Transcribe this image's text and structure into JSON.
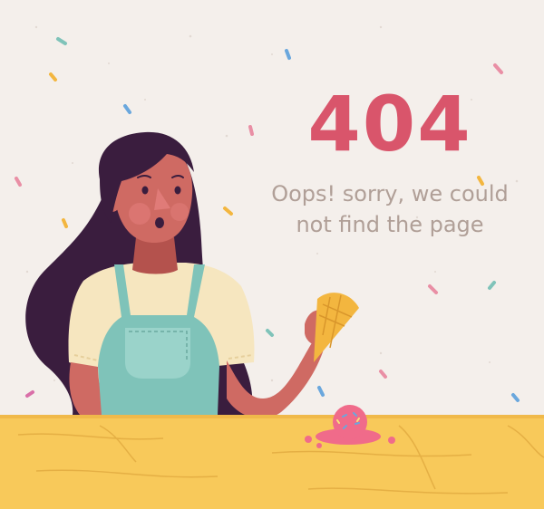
{
  "error": {
    "code": "404",
    "message_line1": "Oops! sorry, we could",
    "message_line2": "not find the page"
  },
  "colors": {
    "background": "#f4efeb",
    "accent": "#d9556b",
    "message_text": "#b09f97",
    "table": "#f8c95a",
    "hair": "#3a1d3e",
    "skin": "#cf6a63",
    "apron": "#7fc3b9",
    "shirt": "#f6e6bf",
    "cone": "#f3b63f",
    "ice_cream": "#f06b8a"
  },
  "illustration": {
    "subject-icon": "woman-with-dropped-ice-cream-icon"
  }
}
